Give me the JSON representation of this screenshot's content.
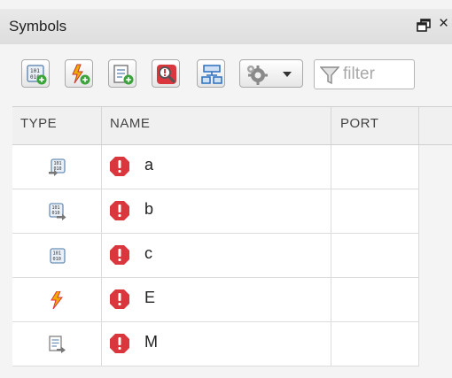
{
  "panel": {
    "title": "Symbols",
    "undock_icon": "undock-icon",
    "close_glyph": "×"
  },
  "toolbar": {
    "buttons": [
      {
        "name": "add-data-button",
        "icon": "data-plus-icon"
      },
      {
        "name": "add-event-button",
        "icon": "event-plus-icon"
      },
      {
        "name": "add-message-button",
        "icon": "message-plus-icon"
      },
      {
        "name": "resolve-undefined-button",
        "icon": "magnifier-warning-icon"
      },
      {
        "name": "hierarchy-button",
        "icon": "hierarchy-icon"
      },
      {
        "name": "settings-menu-button",
        "icon": "gear-icon"
      }
    ],
    "filter": {
      "placeholder": "filter",
      "value": ""
    }
  },
  "table": {
    "columns": [
      "TYPE",
      "NAME",
      "PORT"
    ],
    "rows": [
      {
        "type_icon": "input-data-icon",
        "status_icon": "error-icon",
        "name": "a",
        "port": ""
      },
      {
        "type_icon": "output-data-icon",
        "status_icon": "error-icon",
        "name": "b",
        "port": ""
      },
      {
        "type_icon": "local-data-icon",
        "status_icon": "error-icon",
        "name": "c",
        "port": ""
      },
      {
        "type_icon": "event-icon",
        "status_icon": "error-icon",
        "name": "E",
        "port": ""
      },
      {
        "type_icon": "message-icon",
        "status_icon": "error-icon",
        "name": "M",
        "port": ""
      }
    ]
  },
  "colors": {
    "error": "#d9363e",
    "event": "#f2a900",
    "data_icon_border": "#6a8fb5",
    "titlebar": "#e4e4e4"
  }
}
